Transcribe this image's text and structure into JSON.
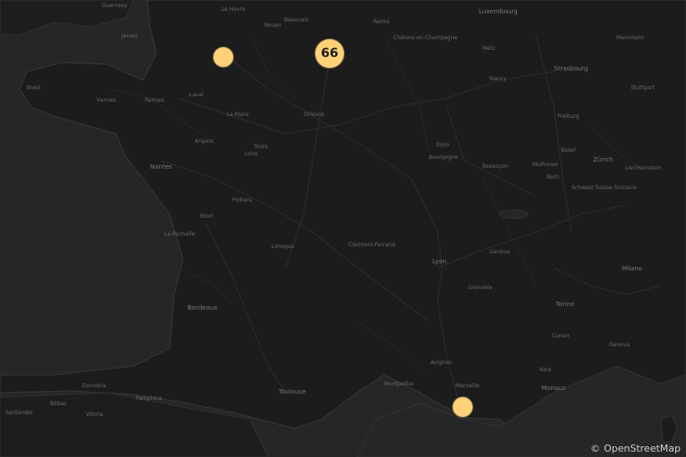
{
  "map": {
    "theme": "dark",
    "colors": {
      "land": "#1f1f1f",
      "sea": "#262626",
      "coast": "#343434",
      "marker": "#ffd27a",
      "cluster_text": "#1a1a1a"
    },
    "labels": [
      "Guernsey",
      "Jersey",
      "Le Havre",
      "Rouen",
      "Beauvais",
      "Reims",
      "Luxembourg",
      "Châlons-en-Champagne",
      "Metz",
      "Nancy",
      "Strasbourg",
      "Mannheim",
      "Stuttgart",
      "Freiburg",
      "Basel",
      "Mulhouse",
      "Zürich",
      "Bern",
      "Schweiz Suisse Svizzera",
      "Liechtenstein",
      "Rennes",
      "Laval",
      "Le Mans",
      "Tours",
      "Orléans",
      "Angers",
      "Nantes",
      "Dijon",
      "Besançon",
      "Niort",
      "La Rochelle",
      "Poitiers",
      "Limoges",
      "Clermont-Ferrand",
      "Lyon",
      "Grenoble",
      "Genève",
      "Torino",
      "Milano",
      "Bordeaux",
      "Toulouse",
      "Montpellier",
      "Avignon",
      "Marseille",
      "Nice",
      "Monaco",
      "Cuneo",
      "Genova",
      "Pamplona",
      "Donostia",
      "Vitoria",
      "Bilbao",
      "Santander",
      "Brest",
      "Vannes",
      "Loire",
      "Bourgogne"
    ],
    "markers": [
      {
        "type": "single",
        "label": ""
      },
      {
        "type": "cluster",
        "label": "66"
      },
      {
        "type": "single",
        "label": ""
      }
    ],
    "attribution": {
      "symbol": "©",
      "text": "OpenStreetMap"
    }
  }
}
